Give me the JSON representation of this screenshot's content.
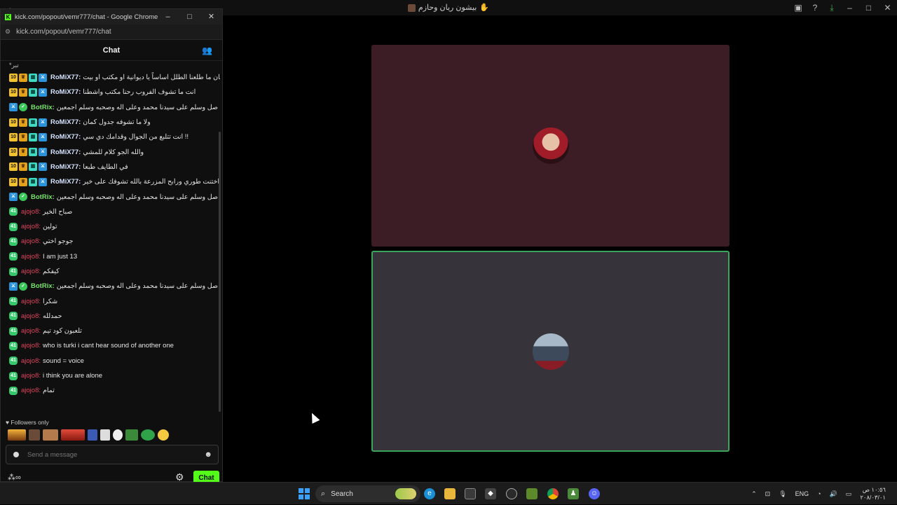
{
  "background_window": {
    "back_icon": "back-arrow-icon",
    "title": "بيشون ريان وحازم",
    "title_emoji": "✋"
  },
  "popout": {
    "window_title": "kick.com/popout/vemr777/chat - Google Chrome",
    "url": "kick.com/popout/vemr777/chat",
    "chat_title": "Chat",
    "first_line_fragment": "*تبر",
    "messages": [
      {
        "badges": [
          "10",
          "crown",
          "gift",
          "sword"
        ],
        "user": "RoMiX77:",
        "user_class": "u-romix",
        "text": "من زمان ما طلعنا الطلل اساساً يا ديوانية او مكتب او بيت"
      },
      {
        "badges": [
          "10",
          "crown",
          "gift",
          "sword"
        ],
        "user": "RoMiX77:",
        "user_class": "u-romix",
        "text": "انت ما تشوف الفروب رحنا مكتب واشطنا"
      },
      {
        "badges": [
          "bot",
          "verified"
        ],
        "user": "BotRix:",
        "user_class": "u-botrix",
        "text": "اللهم صل وسلم على سيدنا محمد وعلى اله وصحبه وسلم اجمعين"
      },
      {
        "badges": [
          "10",
          "crown",
          "gift",
          "sword"
        ],
        "user": "RoMiX77:",
        "user_class": "u-romix",
        "text": "ولا ما تشوفه جدول كمان"
      },
      {
        "badges": [
          "10",
          "crown",
          "gift",
          "sword"
        ],
        "user": "RoMiX77:",
        "user_class": "u-romix",
        "text": "انت تتلبع من الجوال وقدامك دي سي !!"
      },
      {
        "badges": [
          "10",
          "crown",
          "gift",
          "sword"
        ],
        "user": "RoMiX77:",
        "user_class": "u-romix",
        "text": "والله الجو كلام للمشي"
      },
      {
        "badges": [
          "10",
          "crown",
          "gift",
          "sword"
        ],
        "user": "RoMiX77:",
        "user_class": "u-romix",
        "text": "في الطايف طبعا"
      },
      {
        "badges": [
          "10",
          "crown",
          "gift",
          "sword"
        ],
        "user": "RoMiX77:",
        "user_class": "u-romix",
        "text": "اختنت طوري ورابح المزرعة بالله تشوفك على خير 🤍"
      },
      {
        "badges": [
          "bot",
          "verified"
        ],
        "user": "BotRix:",
        "user_class": "u-botrix",
        "text": "اللهم صل وسلم على سيدنا محمد وعلى اله وصحبه وسلم اجمعين"
      },
      {
        "badges": [
          "41"
        ],
        "user": "ajojo8:",
        "user_class": "u-ajojo",
        "text": "صباح الخير"
      },
      {
        "badges": [
          "41"
        ],
        "user": "ajojo8:",
        "user_class": "u-ajojo",
        "text": "تولين"
      },
      {
        "badges": [
          "41"
        ],
        "user": "ajojo8:",
        "user_class": "u-ajojo",
        "text": "جوجو اختي"
      },
      {
        "badges": [
          "41"
        ],
        "user": "ajojo8:",
        "user_class": "u-ajojo",
        "text": "I am just 13"
      },
      {
        "badges": [
          "41"
        ],
        "user": "ajojo8:",
        "user_class": "u-ajojo",
        "text": "كيفكم"
      },
      {
        "badges": [
          "bot",
          "verified"
        ],
        "user": "BotRix:",
        "user_class": "u-botrix",
        "text": "اللهم صل وسلم على سيدنا محمد وعلى اله وصحبه وسلم اجمعين"
      },
      {
        "badges": [
          "41"
        ],
        "user": "ajojo8:",
        "user_class": "u-ajojo",
        "text": "شكرا"
      },
      {
        "badges": [
          "41"
        ],
        "user": "ajojo8:",
        "user_class": "u-ajojo",
        "text": "حمدلله"
      },
      {
        "badges": [
          "41"
        ],
        "user": "ajojo8:",
        "user_class": "u-ajojo",
        "text": "تلعبون كود تيم"
      },
      {
        "badges": [
          "41"
        ],
        "user": "ajojo8:",
        "user_class": "u-ajojo",
        "text": "who is turki i cant hear sound of another one"
      },
      {
        "badges": [
          "41"
        ],
        "user": "ajojo8:",
        "user_class": "u-ajojo",
        "text": "sound = voice"
      },
      {
        "badges": [
          "41"
        ],
        "user": "ajojo8:",
        "user_class": "u-ajojo",
        "text": "i think you are alone"
      },
      {
        "badges": [
          "41"
        ],
        "user": "ajojo8:",
        "user_class": "u-ajojo",
        "text": "تمام"
      }
    ],
    "followers_label": "Followers only",
    "message_placeholder": "Send a message",
    "send_label": "Chat"
  },
  "taskbar": {
    "search_label": "Search",
    "language": "ENG",
    "time": "١٠:٥٦ ص",
    "date": "٢٠٨/٠٣/٠١"
  }
}
